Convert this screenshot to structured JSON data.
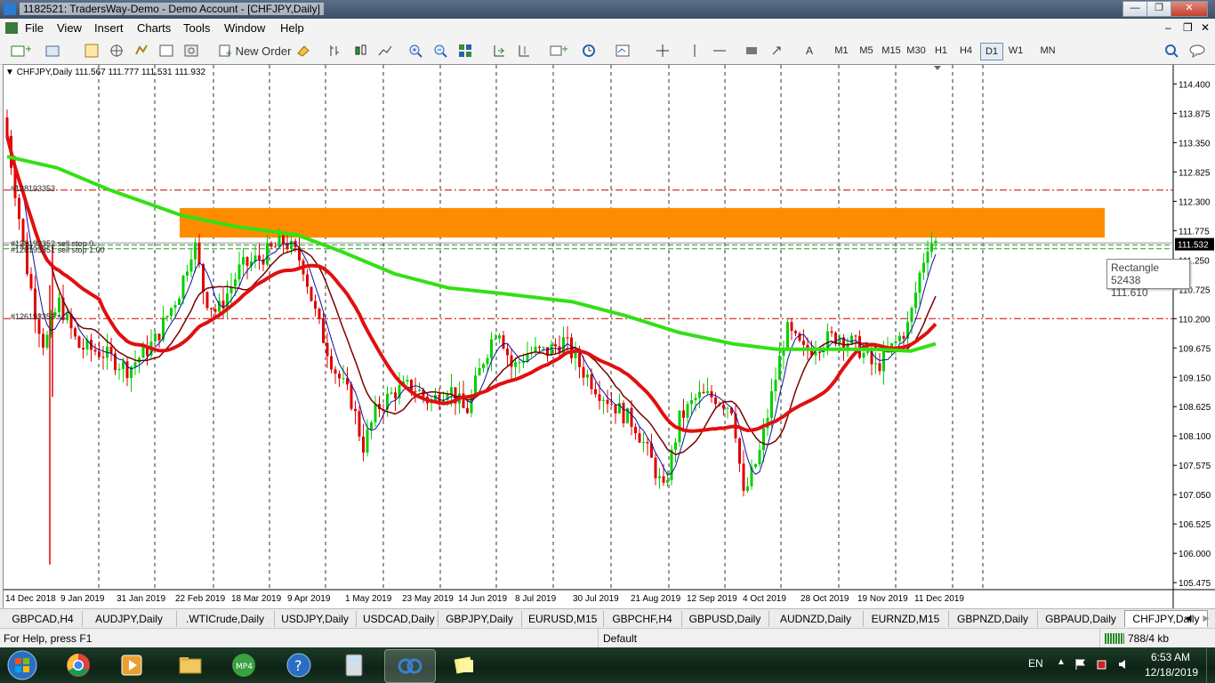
{
  "window": {
    "title": "1182521: TradersWay-Demo - Demo Account - [CHFJPY,Daily]",
    "controls": {
      "minimize": "—",
      "maximize": "❐",
      "close": "✕"
    },
    "inner_controls": {
      "minimize": "–",
      "restore": "❐",
      "close": "✕"
    }
  },
  "menu": [
    "File",
    "View",
    "Insert",
    "Charts",
    "Tools",
    "Window",
    "Help"
  ],
  "toolbar": {
    "new_order": "New Order",
    "timeframes": [
      "M1",
      "M5",
      "M15",
      "M30",
      "H1",
      "H4",
      "D1",
      "W1",
      "MN"
    ],
    "active_timeframe": "D1"
  },
  "chart": {
    "header": "CHFJPY,Daily  111.567 111.777 111.531 111.932",
    "price_labels": [
      "114.400",
      "113.875",
      "113.350",
      "112.825",
      "112.300",
      "111.775",
      "111.250",
      "110.725",
      "110.200",
      "109.675",
      "109.150",
      "108.625",
      "108.100",
      "107.575",
      "107.050",
      "106.525",
      "106.000",
      "105.475"
    ],
    "current_price": "111.532",
    "date_labels": [
      "14 Dec 2018",
      "9 Jan 2019",
      "31 Jan 2019",
      "22 Feb 2019",
      "18 Mar 2019",
      "9 Apr 2019",
      "1 May 2019",
      "23 May 2019",
      "14 Jun 2019",
      "8 Jul 2019",
      "30 Jul 2019",
      "21 Aug 2019",
      "12 Sep 2019",
      "4 Oct 2019",
      "28 Oct 2019",
      "19 Nov 2019",
      "11 Dec 2019"
    ],
    "order_labels": {
      "top": "#128193353",
      "stops": "#128193352 sell stop 0.",
      "stops2": "#128193351 sell stop 1.00",
      "bottom": "#126193353 s"
    },
    "tooltip": {
      "name": "Rectangle 52438",
      "value": "111.610"
    },
    "colors": {
      "up": "#00d000",
      "down": "#e00000",
      "ma_fast": "#1010a0",
      "ma_mid": "#7a0000",
      "ma_slow": "#e01010",
      "ma_200": "#33e014",
      "zone": "#ff8c00"
    }
  },
  "tabs": [
    "GBPCAD,H4",
    "AUDJPY,Daily",
    ".WTICrude,Daily",
    "USDJPY,Daily",
    "USDCAD,Daily",
    "GBPJPY,Daily",
    "EURUSD,M15",
    "GBPCHF,H4",
    "GBPUSD,Daily",
    "AUDNZD,Daily",
    "EURNZD,M15",
    "GBPNZD,Daily",
    "GBPAUD,Daily",
    "CHFJPY,Daily"
  ],
  "active_tab": "CHFJPY,Daily",
  "status": {
    "help": "For Help, press F1",
    "profile": "Default",
    "traffic": "788/4 kb"
  },
  "taskbar": {
    "lang": "EN",
    "time": "6:53 AM",
    "date": "12/18/2019",
    "apps": [
      "windows-start",
      "chrome",
      "media-player",
      "file-explorer",
      "mp4-converter",
      "help",
      "calculator",
      "metatrader",
      "sticky-notes"
    ]
  }
}
